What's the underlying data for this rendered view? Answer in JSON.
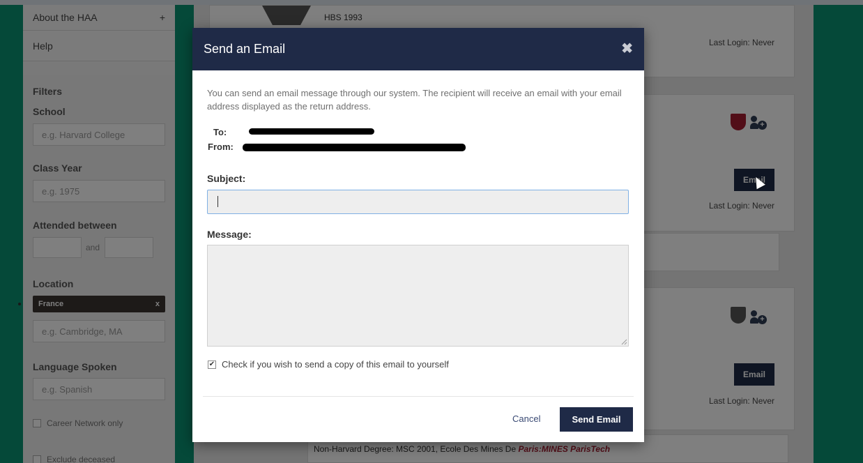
{
  "sidebar": {
    "nav": [
      {
        "label": "About the HAA",
        "suffix": "+"
      },
      {
        "label": "Help",
        "suffix": ""
      }
    ],
    "filters": {
      "heading": "Filters",
      "school": {
        "label": "School",
        "placeholder": "e.g. Harvard College"
      },
      "class_year": {
        "label": "Class Year",
        "placeholder": "e.g. 1975"
      },
      "attended": {
        "label": "Attended between",
        "and_text": "and"
      },
      "location": {
        "label": "Location",
        "tag": "France",
        "tag_remove": "x",
        "placeholder": "e.g. Cambridge, MA"
      },
      "language": {
        "label": "Language Spoken",
        "placeholder": "e.g. Spanish"
      },
      "career_network": "Career Network only",
      "exclude_deceased": "Exclude deceased"
    }
  },
  "results": {
    "card1": {
      "school": "HBS 1993",
      "last_login": "Last Login: Never"
    },
    "card2": {
      "email_button": "Email",
      "last_login": "Last Login: Never"
    },
    "card3": {
      "email_button": "Email",
      "last_login": "Last Login: Never"
    },
    "card4": {
      "degree": "Non-Harvard Degree: MSC 2001, Ecole Des Mines De",
      "highlight": "Paris:MINES  ParisTech"
    }
  },
  "modal": {
    "title": "Send an Email",
    "close": "✖",
    "intro": "You can send an email message through our system. The recipient will receive an email with your email address displayed as the return address.",
    "to_label": "To:",
    "from_label": "From:",
    "subject_label": "Subject:",
    "subject_value": "",
    "message_label": "Message:",
    "message_value": "",
    "copy_checkbox": {
      "label": "Check if you wish to send a copy of this email to yourself",
      "checked": true,
      "mark": "✔"
    },
    "cancel": "Cancel",
    "send": "Send Email"
  },
  "colors": {
    "navy": "#1f2a47",
    "teal": "#0b9373",
    "crimson": "#a51c30",
    "location_highlight": "#a51c30"
  }
}
